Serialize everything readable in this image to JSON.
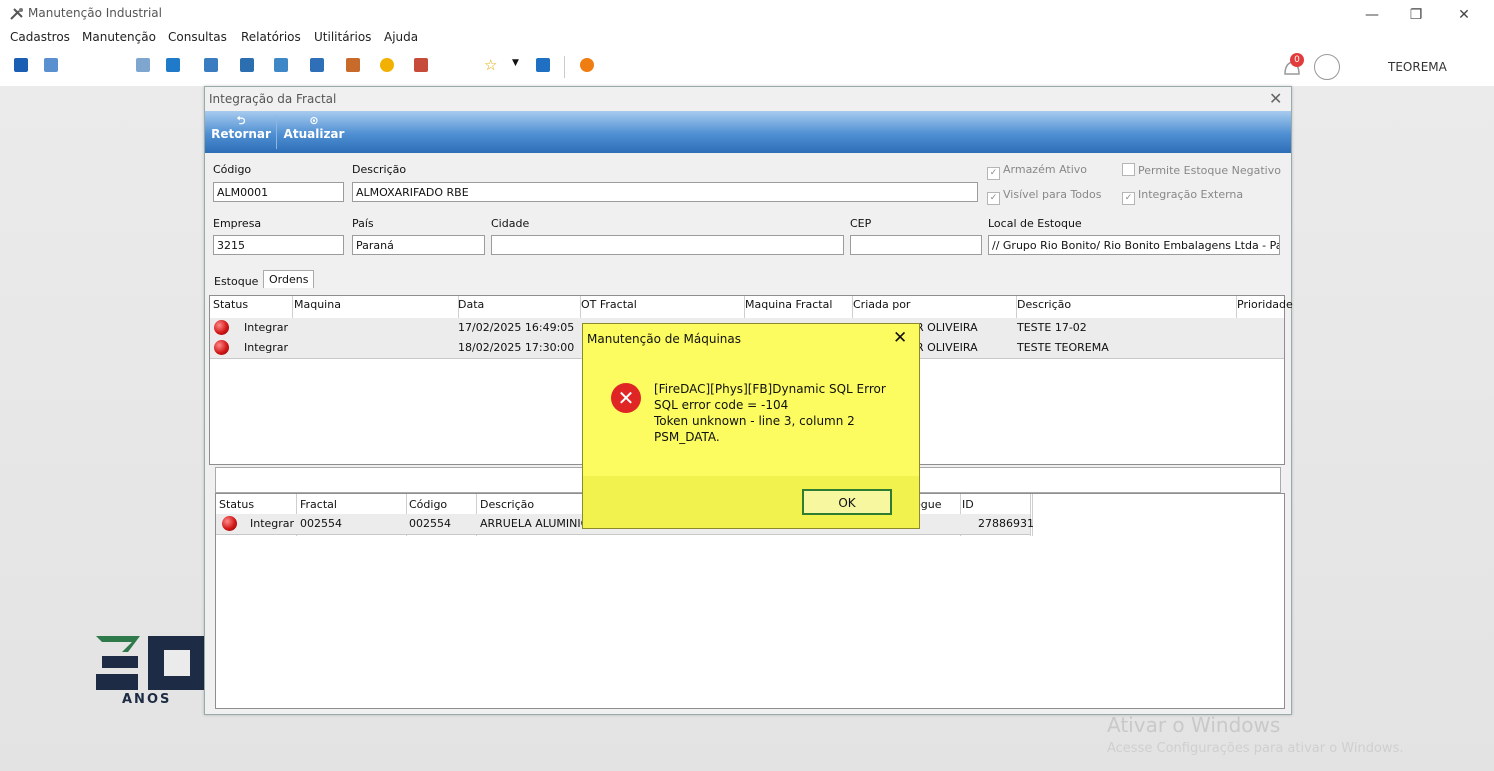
{
  "app": {
    "title": "Manutenção Industrial",
    "user": "TEOREMA"
  },
  "window_controls": {
    "minimize": "—",
    "restore": "❐",
    "close": "✕"
  },
  "menu": [
    "Cadastros",
    "Manutenção",
    "Consultas",
    "Relatórios",
    "Utilitários",
    "Ajuda"
  ],
  "toolbar": {
    "notification_count": "0"
  },
  "form": {
    "title": "Integração da Fractal",
    "close": "✕",
    "buttons": {
      "back": "Retornar",
      "refresh": "Atualizar"
    },
    "labels": {
      "codigo": "Código",
      "descricao": "Descrição",
      "empresa": "Empresa",
      "pais": "País",
      "cidade": "Cidade",
      "cep": "CEP",
      "local": "Local de Estoque"
    },
    "values": {
      "codigo": "ALM0001",
      "descricao": "ALMOXARIFADO RBE",
      "empresa": "3215",
      "pais": "Paraná",
      "cidade": "",
      "cep": "",
      "local": "// Grupo Rio Bonito/ Rio Bonito Embalagens Ltda - Para"
    },
    "checks": {
      "armazem_ativo": "Armazém Ativo",
      "permite_negativo": "Permite Estoque Negativo",
      "visivel": "Visível para Todos",
      "integracao": "Integração Externa"
    },
    "tabs": [
      "Estoque",
      "Ordens"
    ]
  },
  "orders_grid": {
    "headers": [
      "Status",
      "Maquina",
      "Data",
      "OT Fractal",
      "Maquina Fractal",
      "Criada por",
      "Descrição",
      "Prioridade"
    ],
    "rows": [
      {
        "status": "Integrar",
        "maquina": "",
        "data": "17/02/2025 16:49:05",
        "criada": "R OLIVEIRA",
        "descricao": "TESTE 17-02"
      },
      {
        "status": "Integrar",
        "maquina": "",
        "data": "18/02/2025 17:30:00",
        "criada": "R OLIVEIRA",
        "descricao": "TESTE TEOREMA"
      }
    ]
  },
  "items_grid": {
    "headers": [
      "Status",
      "Fractal",
      "Código",
      "Descrição",
      "egue",
      "ID"
    ],
    "rows": [
      {
        "status": "Integrar",
        "fractal": "002554",
        "codigo": "002554",
        "descricao": "ARRUELA ALUMINIO",
        "id": "27886931"
      }
    ]
  },
  "logo": {
    "number": "30",
    "text": "ANOS"
  },
  "watermark": {
    "title": "Ativar o Windows",
    "subtitle": "Acesse Configurações para ativar o Windows."
  },
  "dialog": {
    "title": "Manutenção de Máquinas",
    "close": "✕",
    "icon": "✕",
    "lines": [
      "[FireDAC][Phys][FB]Dynamic SQL Error",
      "SQL error code = -104",
      "Token unknown - line 3, column 2",
      "PSM_DATA."
    ],
    "ok": "OK"
  },
  "colors": {
    "ribbon": "#2d6eb8",
    "dialog_bg": "#fcfc60",
    "error": "#e02525",
    "status_dot": "#d21818"
  }
}
